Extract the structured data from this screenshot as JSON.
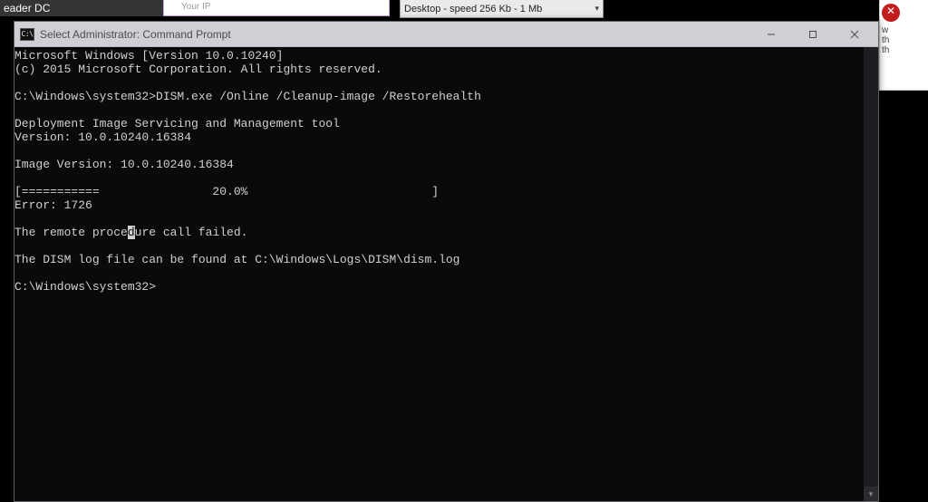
{
  "background": {
    "reader_title_fragment": "eader DC",
    "purple_label": "Your IP",
    "speed_dropdown": "Desktop - speed  256 Kb - 1 Mb",
    "right_lines": [
      "w",
      "th",
      "th"
    ]
  },
  "cmd": {
    "icon_text": "C:\\",
    "title": "Select Administrator: Command Prompt",
    "lines": {
      "l01": "Microsoft Windows [Version 10.0.10240]",
      "l02": "(c) 2015 Microsoft Corporation. All rights reserved.",
      "l03": "",
      "l04": "C:\\Windows\\system32>DISM.exe /Online /Cleanup-image /Restorehealth",
      "l05": "",
      "l06": "Deployment Image Servicing and Management tool",
      "l07": "Version: 10.0.10240.16384",
      "l08": "",
      "l09": "Image Version: 10.0.10240.16384",
      "l10": "",
      "l11": "[===========                20.0%                          ]",
      "l12": "Error: 1726",
      "l13": "",
      "l14a": "The remote proce",
      "l14cur": "d",
      "l14b": "ure call failed.",
      "l15": "",
      "l16": "The DISM log file can be found at C:\\Windows\\Logs\\DISM\\dism.log",
      "l17": "",
      "l18": "C:\\Windows\\system32>"
    }
  }
}
